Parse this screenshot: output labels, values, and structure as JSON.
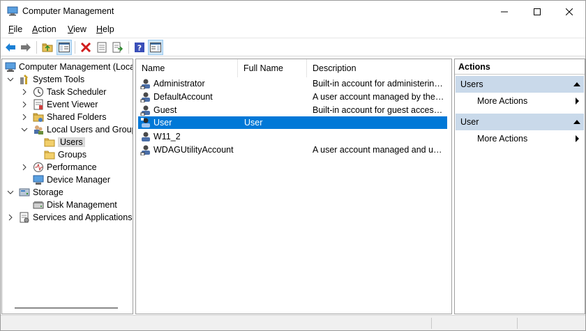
{
  "window": {
    "title": "Computer Management"
  },
  "menu": [
    {
      "accel": "F",
      "rest": "ile"
    },
    {
      "accel": "A",
      "rest": "ction"
    },
    {
      "accel": "V",
      "rest": "iew"
    },
    {
      "accel": "H",
      "rest": "elp"
    }
  ],
  "toolbar": {
    "buttons": [
      "back-arrow",
      "forward-arrow",
      "up-folder",
      "show-hide-tree",
      "delete",
      "properties",
      "export-list",
      "help",
      "show-hide-action-pane"
    ]
  },
  "tree": {
    "items": [
      {
        "label": "Computer Management (Local",
        "icon": "computer-management-icon"
      },
      {
        "label": "System Tools",
        "icon": "system-tools-icon"
      },
      {
        "label": "Task Scheduler",
        "icon": "clock-icon"
      },
      {
        "label": "Event Viewer",
        "icon": "event-viewer-icon"
      },
      {
        "label": "Shared Folders",
        "icon": "shared-folder-icon"
      },
      {
        "label": "Local Users and Groups",
        "icon": "users-groups-icon"
      },
      {
        "label": "Users",
        "icon": "folder-icon"
      },
      {
        "label": "Groups",
        "icon": "folder-icon"
      },
      {
        "label": "Performance",
        "icon": "performance-icon"
      },
      {
        "label": "Device Manager",
        "icon": "device-manager-icon"
      },
      {
        "label": "Storage",
        "icon": "storage-icon"
      },
      {
        "label": "Disk Management",
        "icon": "disk-icon"
      },
      {
        "label": "Services and Applications",
        "icon": "services-icon"
      }
    ]
  },
  "list": {
    "columns": [
      "Name",
      "Full Name",
      "Description"
    ],
    "rows": [
      {
        "name": "Administrator",
        "full_name": "",
        "description": "Built-in account for administering..."
      },
      {
        "name": "DefaultAccount",
        "full_name": "",
        "description": "A user account managed by the s..."
      },
      {
        "name": "Guest",
        "full_name": "",
        "description": "Built-in account for guest access t..."
      },
      {
        "name": "User",
        "full_name": "User",
        "description": ""
      },
      {
        "name": "W11_2",
        "full_name": "",
        "description": ""
      },
      {
        "name": "WDAGUtilityAccount",
        "full_name": "",
        "description": "A user account managed and use..."
      }
    ]
  },
  "actions": {
    "title": "Actions",
    "sections": [
      {
        "header": "Users",
        "item": "More Actions"
      },
      {
        "header": "User",
        "item": "More Actions"
      }
    ]
  },
  "colors": {
    "selection": "#0078d7",
    "section_header": "#c9d9ea",
    "tree_selection": "#d9d9d9"
  }
}
